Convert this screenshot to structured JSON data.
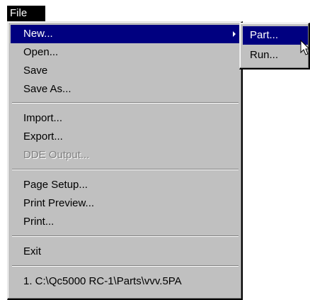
{
  "menubar": {
    "file_label": "File"
  },
  "file_menu": {
    "items": [
      {
        "label": "New...",
        "has_submenu": true
      },
      {
        "label": "Open..."
      },
      {
        "label": "Save"
      },
      {
        "label": "Save As..."
      },
      {
        "label": "Import..."
      },
      {
        "label": "Export..."
      },
      {
        "label": "DDE Output...",
        "disabled": true
      },
      {
        "label": "Page Setup..."
      },
      {
        "label": "Print Preview..."
      },
      {
        "label": "Print..."
      },
      {
        "label": "Exit"
      },
      {
        "label": "1. C:\\Qc5000 RC-1\\Parts\\vvv.5PA"
      }
    ]
  },
  "new_submenu": {
    "items": [
      {
        "label": "Part..."
      },
      {
        "label": "Run..."
      }
    ]
  },
  "colors": {
    "menu_bg": "#c0c0c0",
    "highlight": "#000080",
    "disabled_text": "#808080"
  },
  "icons": {
    "submenu_arrow": "triangle-right",
    "cursor": "arrow-pointer"
  }
}
